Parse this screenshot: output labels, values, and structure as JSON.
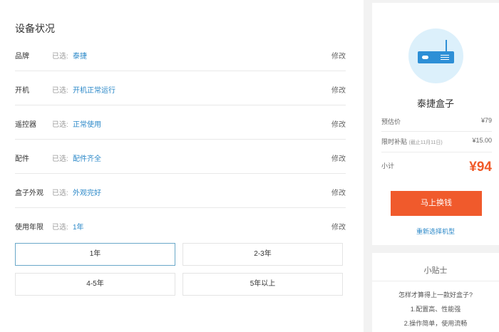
{
  "device_status": {
    "title": "设备状况",
    "selected_prefix": "已选:",
    "modify_label": "修改",
    "rows": [
      {
        "label": "品牌",
        "value": "泰捷"
      },
      {
        "label": "开机",
        "value": "开机正常运行"
      },
      {
        "label": "遥控器",
        "value": "正常使用"
      },
      {
        "label": "配件",
        "value": "配件齐全"
      },
      {
        "label": "盒子外观",
        "value": "外观完好"
      },
      {
        "label": "使用年限",
        "value": "1年"
      }
    ],
    "options": [
      "1年",
      "2-3年",
      "4-5年",
      "5年以上"
    ],
    "selected_option": "1年"
  },
  "summary": {
    "icon": "router-icon",
    "product_name": "泰捷盒子",
    "estimate_label": "预估价",
    "estimate_value": "¥79",
    "subsidy_label": "限时补贴",
    "subsidy_note": "(截止11月11日)",
    "subsidy_value": "¥15.00",
    "subtotal_label": "小计",
    "subtotal_value": "¥94",
    "cta_label": "马上换钱",
    "reselect_label": "重新选择机型",
    "accent_color": "#f05a2c",
    "link_color": "#2b88c8"
  },
  "tips": {
    "title": "小贴士",
    "lines": [
      "怎样才算得上一款好盒子?",
      "1.配置高、性能强",
      "2.操作简单，使用流畅"
    ]
  }
}
